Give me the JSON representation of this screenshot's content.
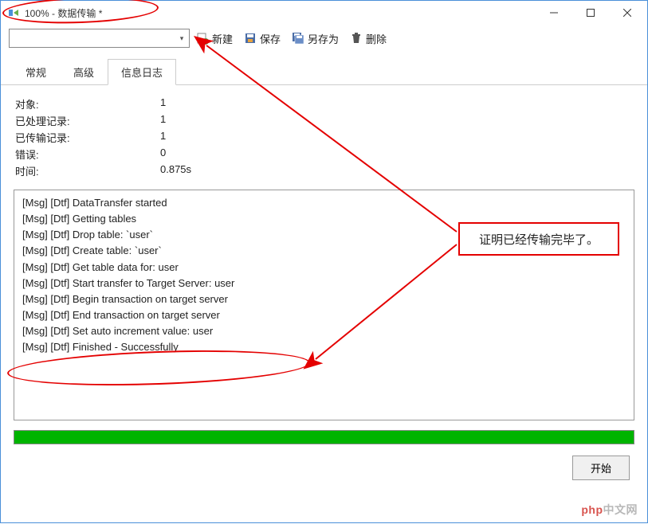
{
  "window": {
    "title": "100% - 数据传输 *"
  },
  "toolbar": {
    "new_label": "新建",
    "save_label": "保存",
    "saveas_label": "另存为",
    "delete_label": "删除"
  },
  "tabs": {
    "general": "常规",
    "advanced": "高级",
    "log": "信息日志"
  },
  "stats": {
    "objects_label": "对象:",
    "objects_value": "1",
    "processed_label": "已处理记录:",
    "processed_value": "1",
    "transferred_label": "已传输记录:",
    "transferred_value": "1",
    "errors_label": "错误:",
    "errors_value": "0",
    "time_label": "时间:",
    "time_value": "0.875s"
  },
  "log": [
    "[Msg] [Dtf] DataTransfer started",
    "[Msg] [Dtf] Getting tables",
    "[Msg] [Dtf] Drop table: `user`",
    "[Msg] [Dtf] Create table: `user`",
    "[Msg] [Dtf] Get table data for: user",
    "[Msg] [Dtf] Start transfer to Target Server: user",
    "[Msg] [Dtf] Begin transaction on target server",
    "[Msg] [Dtf] End transaction on target server",
    "[Msg] [Dtf] Set auto increment value: user",
    "[Msg] [Dtf] Finished - Successfully"
  ],
  "buttons": {
    "start": "开始"
  },
  "annotation": {
    "proof_text": "证明已经传输完毕了。"
  },
  "watermark": {
    "prefix": "php",
    "suffix": "中文网"
  }
}
